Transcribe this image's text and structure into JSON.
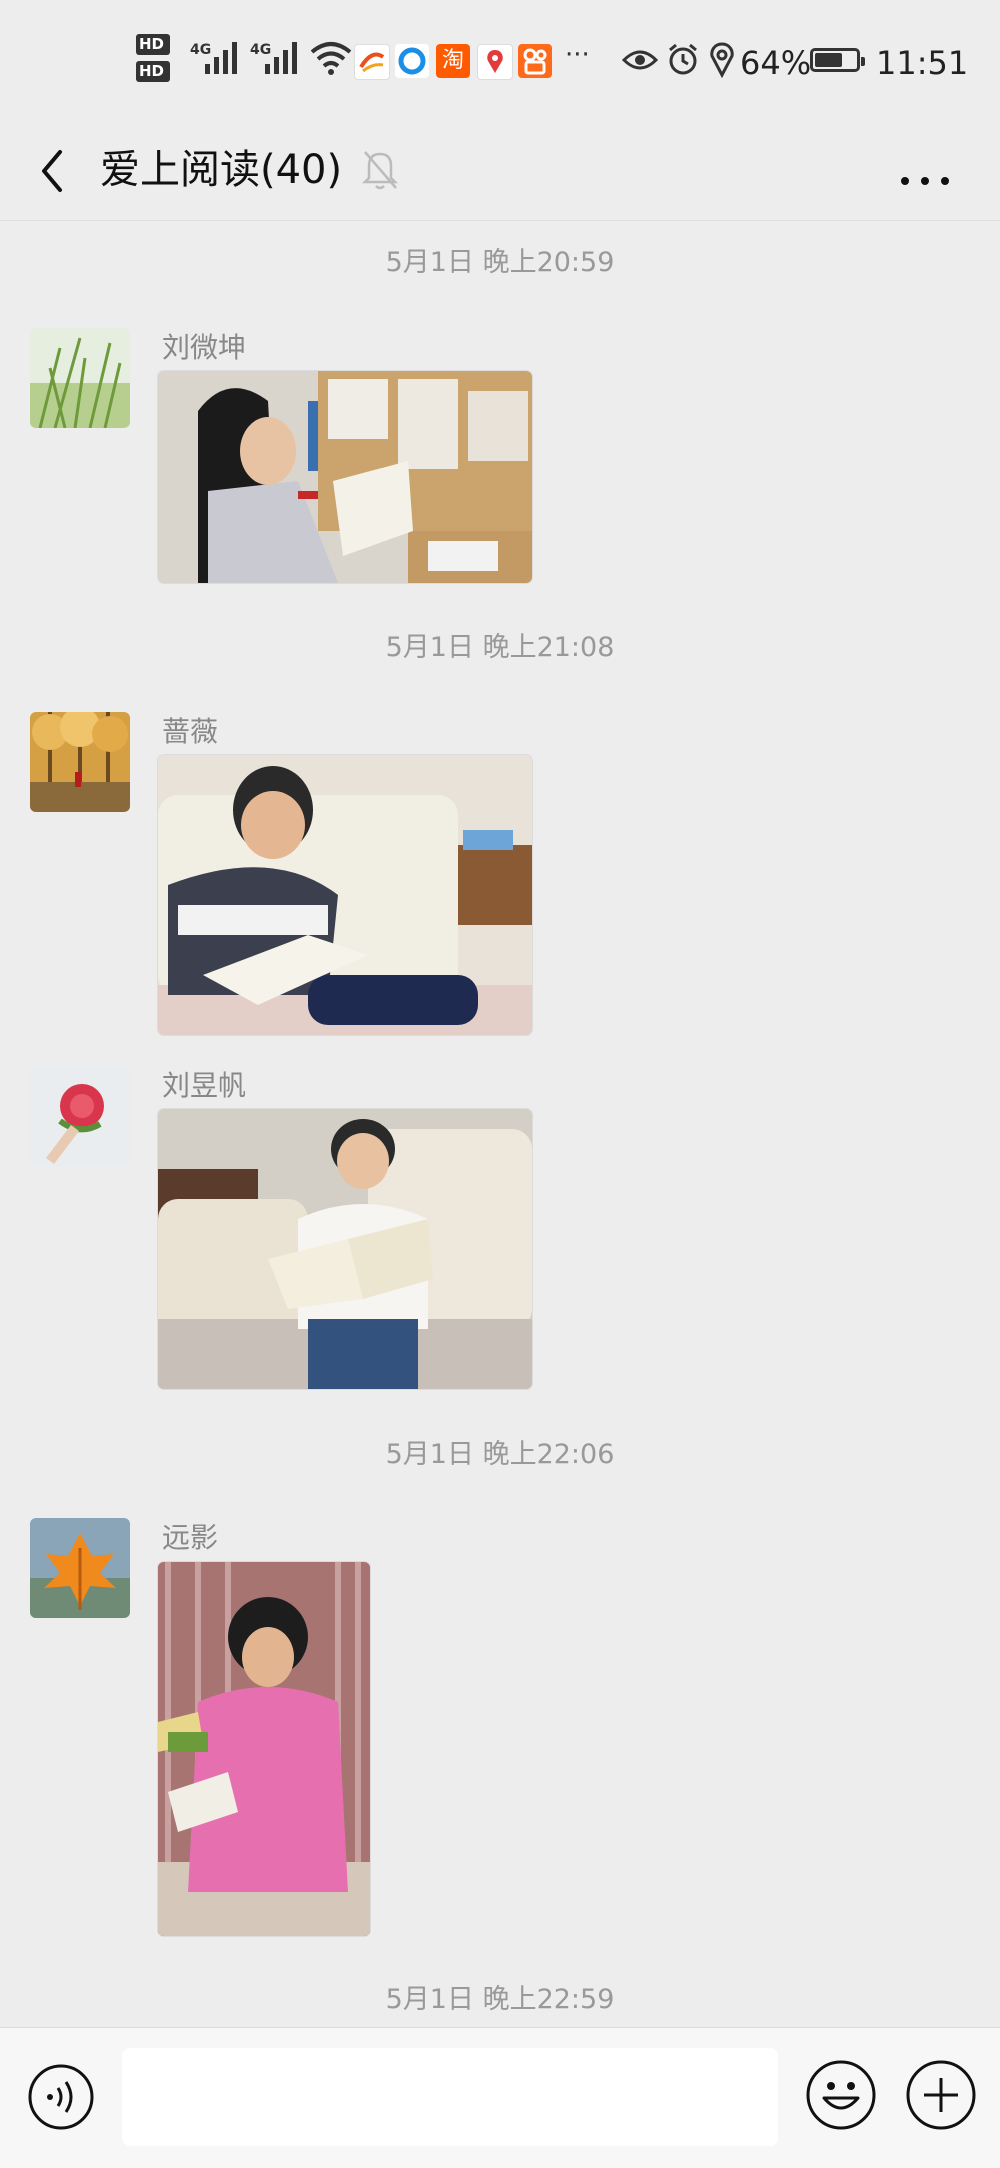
{
  "status_bar": {
    "hd1": "HD",
    "hd2": "HD",
    "net1": "4G",
    "net2": "4G",
    "overflow": "···",
    "battery_percent": "64%",
    "battery_level": 0.64,
    "time": "11:51",
    "icons": [
      "eye-icon",
      "alarm-icon",
      "location-icon"
    ]
  },
  "header": {
    "title": "爱上阅读(40)",
    "back_icon": "chevron-left-icon",
    "mute_icon": "bell-off-icon",
    "more_icon": "more-dots-icon"
  },
  "messages": [
    {
      "timestamp": "5月1日 晚上20:59",
      "sender": "刘微坤",
      "content": "photo"
    },
    {
      "timestamp": "5月1日 晚上21:08",
      "sender": "蔷薇",
      "content": "photo"
    },
    {
      "sender": "刘昱帆",
      "content": "photo"
    },
    {
      "timestamp": "5月1日 晚上22:06",
      "sender": "远影",
      "content": "photo"
    }
  ],
  "last_timestamp": "5月1日 晚上22:59",
  "input_bar": {
    "voice_icon": "voice-icon",
    "emoji_icon": "emoji-icon",
    "plus_icon": "plus-icon",
    "input_value": ""
  }
}
